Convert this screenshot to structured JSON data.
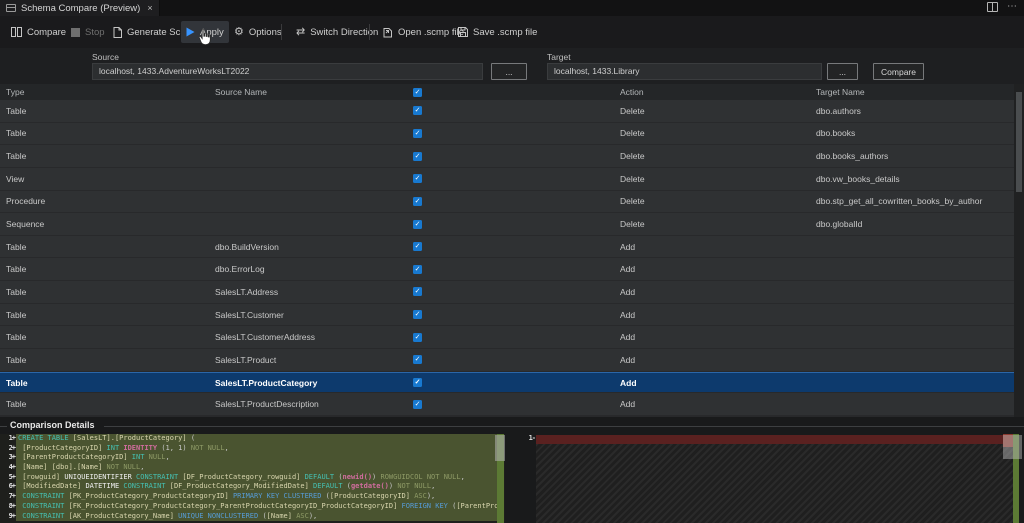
{
  "tab": {
    "title": "Schema Compare (Preview)",
    "close_icon": "×"
  },
  "editor_actions": {
    "more_label": "⋯"
  },
  "toolbar": {
    "items": [
      {
        "label": "Compare",
        "icon": "compare-icon",
        "disabled": false,
        "hovered": false
      },
      {
        "label": "Stop",
        "icon": "stop-icon",
        "disabled": true,
        "hovered": false
      },
      {
        "label": "Generate Script",
        "icon": "script-icon",
        "disabled": false,
        "hovered": false
      },
      {
        "label": "Apply",
        "icon": "play-icon",
        "disabled": false,
        "hovered": true
      },
      {
        "label": "Options",
        "icon": "gear-icon",
        "disabled": false,
        "hovered": false
      },
      {
        "label": "Switch Direction",
        "icon": "switch-direction-icon",
        "disabled": false,
        "hovered": false
      },
      {
        "label": "Open .scmp file",
        "icon": "open-file-icon",
        "disabled": false,
        "hovered": false
      },
      {
        "label": "Save .scmp file",
        "icon": "save-file-icon",
        "disabled": false,
        "hovered": false
      }
    ],
    "switch_glyph": "⇄",
    "gear_glyph": "⚙"
  },
  "connections": {
    "source_label": "Source",
    "source_value": "localhost, 1433.AdventureWorksLT2022",
    "target_label": "Target",
    "target_value": "localhost, 1433.Library",
    "browse_label": "...",
    "compare_button_label": "Compare"
  },
  "grid": {
    "headers": {
      "type": "Type",
      "source": "Source Name",
      "action": "Action",
      "target": "Target Name"
    },
    "header_checkbox_checked": true,
    "check_glyph": "✓",
    "rows": [
      {
        "type": "Table",
        "source": "",
        "checked": true,
        "action": "Delete",
        "target": "dbo.authors",
        "selected": false
      },
      {
        "type": "Table",
        "source": "",
        "checked": true,
        "action": "Delete",
        "target": "dbo.books",
        "selected": false
      },
      {
        "type": "Table",
        "source": "",
        "checked": true,
        "action": "Delete",
        "target": "dbo.books_authors",
        "selected": false
      },
      {
        "type": "View",
        "source": "",
        "checked": true,
        "action": "Delete",
        "target": "dbo.vw_books_details",
        "selected": false
      },
      {
        "type": "Procedure",
        "source": "",
        "checked": true,
        "action": "Delete",
        "target": "dbo.stp_get_all_cowritten_books_by_author",
        "selected": false
      },
      {
        "type": "Sequence",
        "source": "",
        "checked": true,
        "action": "Delete",
        "target": "dbo.globalId",
        "selected": false
      },
      {
        "type": "Table",
        "source": "dbo.BuildVersion",
        "checked": true,
        "action": "Add",
        "target": "",
        "selected": false
      },
      {
        "type": "Table",
        "source": "dbo.ErrorLog",
        "checked": true,
        "action": "Add",
        "target": "",
        "selected": false
      },
      {
        "type": "Table",
        "source": "SalesLT.Address",
        "checked": true,
        "action": "Add",
        "target": "",
        "selected": false
      },
      {
        "type": "Table",
        "source": "SalesLT.Customer",
        "checked": true,
        "action": "Add",
        "target": "",
        "selected": false
      },
      {
        "type": "Table",
        "source": "SalesLT.CustomerAddress",
        "checked": true,
        "action": "Add",
        "target": "",
        "selected": false
      },
      {
        "type": "Table",
        "source": "SalesLT.Product",
        "checked": true,
        "action": "Add",
        "target": "",
        "selected": false
      },
      {
        "type": "Table",
        "source": "SalesLT.ProductCategory",
        "checked": true,
        "action": "Add",
        "target": "",
        "selected": true
      },
      {
        "type": "Table",
        "source": "SalesLT.ProductDescription",
        "checked": true,
        "action": "Add",
        "target": "",
        "selected": false
      }
    ]
  },
  "details": {
    "title": "Comparison Details",
    "left": {
      "lines": [
        {
          "no": "1",
          "sign": "+",
          "tokens": [
            {
              "c": "kw",
              "t": "CREATE TABLE "
            },
            {
              "c": "id",
              "t": "[SalesLT].[ProductCategory] "
            },
            {
              "c": "pl",
              "t": "("
            }
          ]
        },
        {
          "no": "2",
          "sign": "+",
          "tokens": [
            {
              "c": "id",
              "t": " [ProductCategoryID] "
            },
            {
              "c": "kw",
              "t": "INT "
            },
            {
              "c": "fn",
              "t": "IDENTITY "
            },
            {
              "c": "pl",
              "t": "(1, 1) "
            },
            {
              "c": "dm",
              "t": "NOT NULL"
            },
            {
              "c": "pl",
              "t": ","
            }
          ]
        },
        {
          "no": "3",
          "sign": "+",
          "tokens": [
            {
              "c": "id",
              "t": " [ParentProductCategoryID] "
            },
            {
              "c": "kw",
              "t": "INT "
            },
            {
              "c": "dm",
              "t": "NULL"
            },
            {
              "c": "pl",
              "t": ","
            }
          ]
        },
        {
          "no": "4",
          "sign": "+",
          "tokens": [
            {
              "c": "id",
              "t": " [Name] [dbo].[Name] "
            },
            {
              "c": "dm",
              "t": "NOT NULL"
            },
            {
              "c": "pl",
              "t": ","
            }
          ]
        },
        {
          "no": "5",
          "sign": "+",
          "tokens": [
            {
              "c": "id",
              "t": " [rowguid] "
            },
            {
              "c": "wh",
              "t": "UNIQUEIDENTIFIER "
            },
            {
              "c": "kw",
              "t": "CONSTRAINT "
            },
            {
              "c": "id",
              "t": "[DF_ProductCategory_rowguid] "
            },
            {
              "c": "kw",
              "t": "DEFAULT "
            },
            {
              "c": "pl",
              "t": "("
            },
            {
              "c": "fn",
              "t": "newid()"
            },
            {
              "c": "pl",
              "t": ") "
            },
            {
              "c": "dm",
              "t": "ROWGUIDCOL NOT NULL"
            },
            {
              "c": "pl",
              "t": ","
            }
          ]
        },
        {
          "no": "6",
          "sign": "+",
          "tokens": [
            {
              "c": "id",
              "t": " [ModifiedDate] "
            },
            {
              "c": "wh",
              "t": "DATETIME "
            },
            {
              "c": "kw",
              "t": "CONSTRAINT "
            },
            {
              "c": "id",
              "t": "[DF_ProductCategory_ModifiedDate] "
            },
            {
              "c": "kw",
              "t": "DEFAULT "
            },
            {
              "c": "pl",
              "t": "("
            },
            {
              "c": "fn",
              "t": "getdate()"
            },
            {
              "c": "pl",
              "t": ") "
            },
            {
              "c": "dm",
              "t": "NOT NULL"
            },
            {
              "c": "pl",
              "t": ","
            }
          ]
        },
        {
          "no": "7",
          "sign": "+",
          "tokens": [
            {
              "c": "kw",
              "t": " CONSTRAINT "
            },
            {
              "c": "id",
              "t": "[PK_ProductCategory_ProductCategoryID] "
            },
            {
              "c": "kb",
              "t": "PRIMARY KEY CLUSTERED "
            },
            {
              "c": "pl",
              "t": "("
            },
            {
              "c": "id",
              "t": "[ProductCategoryID] "
            },
            {
              "c": "dm",
              "t": "ASC"
            },
            {
              "c": "pl",
              "t": "),"
            }
          ]
        },
        {
          "no": "8",
          "sign": "+",
          "tokens": [
            {
              "c": "kw",
              "t": " CONSTRAINT "
            },
            {
              "c": "id",
              "t": "[FK_ProductCategory_ProductCategory_ParentProductCategoryID_ProductCategoryID] "
            },
            {
              "c": "kb",
              "t": "FOREIGN KEY "
            },
            {
              "c": "pl",
              "t": "("
            },
            {
              "c": "id",
              "t": "[ParentProductCategoryID]"
            }
          ]
        },
        {
          "no": "9",
          "sign": "+",
          "tokens": [
            {
              "c": "kw",
              "t": " CONSTRAINT "
            },
            {
              "c": "id",
              "t": "[AK_ProductCategory_Name] "
            },
            {
              "c": "kb",
              "t": "UNIQUE NONCLUSTERED "
            },
            {
              "c": "pl",
              "t": "("
            },
            {
              "c": "id",
              "t": "[Name] "
            },
            {
              "c": "dm",
              "t": "ASC"
            },
            {
              "c": "pl",
              "t": "),"
            }
          ]
        }
      ]
    },
    "right": {
      "line_no": "1",
      "sign": "-"
    }
  },
  "colors": {
    "accent_blue": "#1879d0",
    "selection_blue": "#0d3a6d",
    "added_line_bg": "#4a5430",
    "deleted_line_bg": "#5a2120",
    "play_icon_blue": "#3794ff",
    "keyword_teal": "#45c0b2",
    "keyword_blue": "#569cd6",
    "function_magenta": "#d16d9e"
  }
}
